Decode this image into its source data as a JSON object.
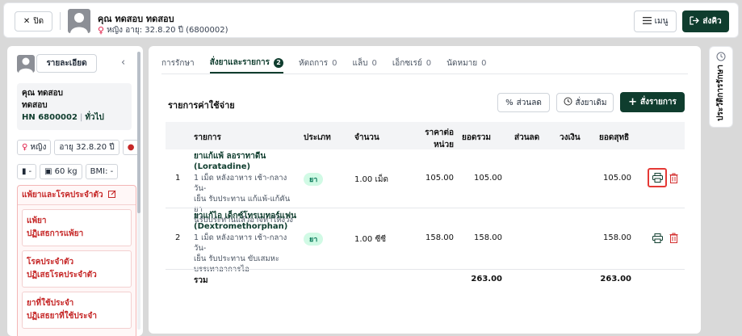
{
  "topbar": {
    "close_label": "ปิด",
    "patient_name": "คุณ ทดสอบ ทดสอบ",
    "patient_info": "หญิง อายุ: 32.8.20 ปี (6800002)",
    "menu_label": "เมนู",
    "send_label": "ส่งคิว"
  },
  "left": {
    "detail_button": "รายละเอียด",
    "name_line1": "คุณ ทดสอบ",
    "name_line2": "ทดสอบ",
    "hn": "HN 6800002",
    "hn_type": "ทั่วไป",
    "gender": "หญิง",
    "age": "อายุ 32.8.20 ปี",
    "blood_group": "-",
    "weight": "60 kg",
    "bmi": "BMI: -",
    "allergy_header": "แพ้ยาและโรคประจำตัว",
    "allergy_items": [
      {
        "title": "แพ้ยา",
        "value": "ปฏิเสธการแพ้ยา"
      },
      {
        "title": "โรคประจำตัว",
        "value": "ปฏิเสธโรคประจำตัว"
      },
      {
        "title": "ยาที่ใช้ประจำ",
        "value": "ปฏิเสธยาที่ใช้ประจำ"
      }
    ]
  },
  "tabs": [
    {
      "label": "การรักษา",
      "count": ""
    },
    {
      "label": "สั่งยาและรายการ",
      "count": "2"
    },
    {
      "label": "หัตถการ",
      "count": "0"
    },
    {
      "label": "แล็บ",
      "count": "0"
    },
    {
      "label": "เอ็กซเรย์",
      "count": "0"
    },
    {
      "label": "นัดหมาย",
      "count": "0"
    }
  ],
  "main": {
    "section_title": "รายการค่าใช้จ่าย",
    "discount_button": "ส่วนลด",
    "reorder_button": "สั่งยาเดิม",
    "add_button": "สั่งรายการ"
  },
  "table": {
    "headers": {
      "item": "รายการ",
      "type": "ประเภท",
      "qty": "จำนวน",
      "price_line1": "ราคาต่อ",
      "price_line2": "หน่วย",
      "total": "ยอดรวม",
      "discount": "ส่วนลด",
      "credit": "วงเงิน",
      "net": "ยอดสุทธิ"
    },
    "rows": [
      {
        "no": "1",
        "name_line1": "ยาแก้แพ้ ลอราทาดีน",
        "name_line2": "(Loratadine)",
        "desc_line1": "1 เม็ด หลังอาหาร เช้า-กลางวัน-",
        "desc_line2": "เย็น รับประทาน แก้แพ้-แก้คัน ยา",
        "desc_line3": "นี้รับประทานแล้วอาจทำให้ง่วง",
        "type": "ยา",
        "qty": "1.00 เม็ด",
        "price": "105.00",
        "total": "105.00",
        "net": "105.00"
      },
      {
        "no": "2",
        "name_line1": "ยาแก้ไอ เด็กซ์โทรเมทอร์แฟน",
        "name_line2": "(Dextromethorphan)",
        "desc_line1": "1 เม็ด หลังอาหาร เช้า-กลางวัน-",
        "desc_line2": "เย็น รับประทาน ขับเสมหะ",
        "desc_line3": "บรรเทาอาการไอ",
        "type": "ยา",
        "qty": "1.00 ซีซี",
        "price": "158.00",
        "total": "158.00",
        "net": "158.00"
      }
    ],
    "sum_label": "รวม",
    "sum_total": "263.00",
    "sum_net": "263.00"
  },
  "right_panel": {
    "label": "ประวัติการรักษา"
  },
  "colors": {
    "primary": "#0f3d2e",
    "danger": "#c62828",
    "badge_bg": "#d1fae5"
  }
}
